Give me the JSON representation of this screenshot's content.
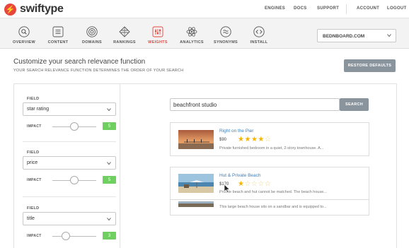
{
  "app": {
    "logo_glyph": "⚡",
    "name": "swiftype",
    "brand_color": "#e8453c"
  },
  "top_links": [
    "ENGINES",
    "DOCS",
    "SUPPORT",
    "ACCOUNT",
    "LOGOUT"
  ],
  "nav": {
    "items": [
      {
        "label": "OVERVIEW",
        "icon": "search-icon"
      },
      {
        "label": "CONTENT",
        "icon": "document-icon"
      },
      {
        "label": "DOMAINS",
        "icon": "target-icon"
      },
      {
        "label": "RANKINGS",
        "icon": "layers-icon"
      },
      {
        "label": "WEIGHTS",
        "icon": "sliders-icon",
        "active": true
      },
      {
        "label": "ANALYTICS",
        "icon": "atom-icon"
      },
      {
        "label": "SYNONYMS",
        "icon": "equivalence-icon"
      },
      {
        "label": "INSTALL",
        "icon": "code-icon"
      }
    ],
    "domain_selected": "BEDNBOARD.COM"
  },
  "header": {
    "title": "Customize your search relevance function",
    "subtitle": "YOUR SEARCH RELEVANCE FUNCTION DETERMINES THE ORDER OF YOUR SEARCH",
    "restore_label": "RESTORE DEFAULTS"
  },
  "fields": [
    {
      "field_label": "FIELD",
      "value": "star rating",
      "impact_label": "IMPACT",
      "impact": "5",
      "slider_fraction": 0.5
    },
    {
      "field_label": "FIELD",
      "value": "price",
      "impact_label": "IMPACT",
      "impact": "5",
      "slider_fraction": 0.5
    },
    {
      "field_label": "FIELD",
      "value": "title",
      "impact_label": "IMPACT",
      "impact": "3",
      "slider_fraction": 0.3
    }
  ],
  "search": {
    "query": "beachfront studio",
    "button_label": "SEARCH"
  },
  "results": [
    {
      "title": "Right on the Pier",
      "price": "$90",
      "rating": 4,
      "max_rating": 5,
      "description": "Private furnished bedroom in a quiet, 2-story townhouse. A...",
      "thumb": "pier-sunset-thumbnail"
    },
    {
      "title": "Hut & Private Beach",
      "price": "$170",
      "rating": 1,
      "max_rating": 5,
      "description": "Private beach and hut cannot be matched. The beach house...",
      "thumb": "beach-hut-thumbnail"
    },
    {
      "title": "",
      "price": "",
      "rating": 0,
      "max_rating": 0,
      "description": "This large beach house sits on a sandbar and is equipped to...",
      "thumb": "beach-house-thumbnail"
    }
  ]
}
